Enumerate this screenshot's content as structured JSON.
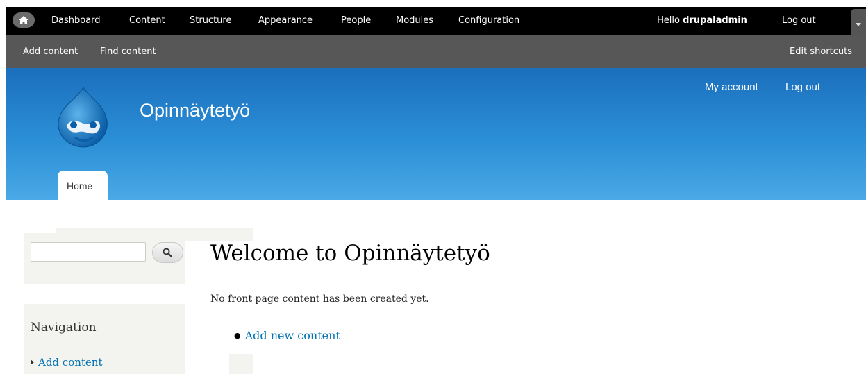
{
  "toolbar": {
    "menu": [
      "Dashboard",
      "Content",
      "Structure",
      "Appearance",
      "People",
      "Modules",
      "Configuration"
    ],
    "hello_prefix": "Hello ",
    "username": "drupaladmin",
    "logout": "Log out"
  },
  "shortcuts": {
    "items": [
      "Add content",
      "Find content"
    ],
    "edit": "Edit shortcuts"
  },
  "header": {
    "site_name": "Opinnäytetyö",
    "secondary": [
      "My account",
      "Log out"
    ],
    "tab_home": "Home"
  },
  "sidebar": {
    "search_placeholder": "",
    "nav_title": "Navigation",
    "nav_items": [
      "Add content"
    ]
  },
  "main": {
    "title": "Welcome to Opinnäytetyö",
    "message": "No front page content has been created yet.",
    "link": "Add new content"
  },
  "colors": {
    "toolbar": "#000000",
    "shortcuts": "#575757",
    "header_top": "#1b6fbd",
    "header_bottom": "#4aa9e6",
    "link": "#0071b3",
    "sidebar_bg": "#f3f3ef"
  },
  "icons": [
    "home-icon",
    "drupal-logo",
    "search-icon",
    "chevron-down-icon",
    "arrow-right-icon"
  ]
}
